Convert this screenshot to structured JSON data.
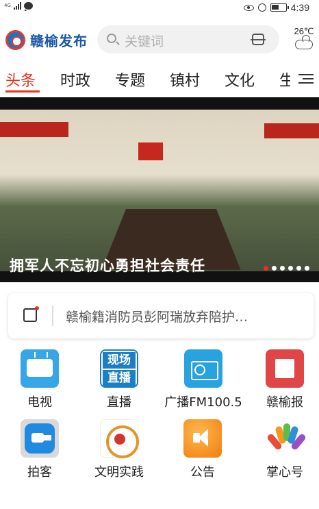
{
  "status_bar": {
    "network": "4G",
    "time": "4:39"
  },
  "header": {
    "app_name": "赣榆发布",
    "search_placeholder": "关键词",
    "weather_temp": "26℃",
    "icons": [
      "logo-icon",
      "search-icon",
      "scan-icon",
      "weather-cloud-icon"
    ]
  },
  "tabs": [
    {
      "label": "头条",
      "active": true
    },
    {
      "label": "时政",
      "active": false
    },
    {
      "label": "专题",
      "active": false
    },
    {
      "label": "镇村",
      "active": false
    },
    {
      "label": "文化",
      "active": false
    },
    {
      "label": "生",
      "active": false
    }
  ],
  "banner": {
    "caption": "拥军人不忘初心勇担社会责任",
    "slide_count": 6,
    "active_slide": 1
  },
  "notice": {
    "text": "赣榆籍消防员彭阿瑞放弃陪护…"
  },
  "services": [
    {
      "label": "电视",
      "icon": "tv-icon"
    },
    {
      "label": "直播",
      "icon": "live-icon",
      "icon_text_1": "现场",
      "icon_text_2": "直播"
    },
    {
      "label": "广播FM100.5",
      "icon": "radio-icon"
    },
    {
      "label": "赣榆报",
      "icon": "newspaper-icon"
    },
    {
      "label": "拍客",
      "icon": "camera-icon"
    },
    {
      "label": "文明实践",
      "icon": "civilization-icon"
    },
    {
      "label": "公告",
      "icon": "announcement-icon"
    },
    {
      "label": "掌心号",
      "icon": "palm-icon"
    }
  ],
  "colors": {
    "accent": "#e8321b",
    "brand": "#1a56a8"
  }
}
